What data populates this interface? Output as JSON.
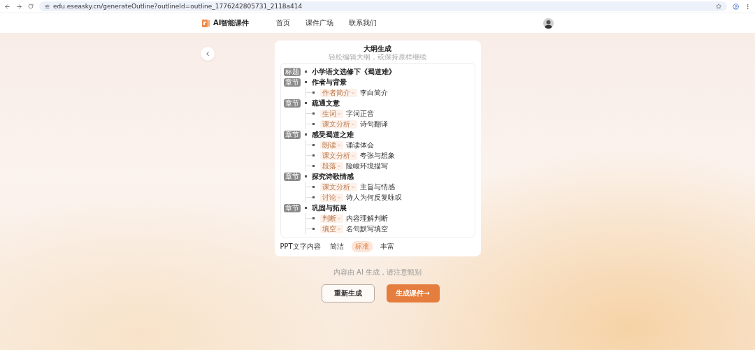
{
  "browser": {
    "url": "edu.eseasky.cn/generateOutline?outlineId=outline_1776242805731_2118a414"
  },
  "nav": {
    "brand": "AI智能课件",
    "links": [
      "首页",
      "课件广场",
      "联系我们"
    ]
  },
  "outline": {
    "title": "大纲生成",
    "subtitle": "轻松编辑大纲，或保持原样继续",
    "items": [
      {
        "tag": "标题",
        "text": "小学语文选修下《蜀道难》"
      },
      {
        "tag": "章节",
        "text": "作者与背景",
        "children": [
          {
            "type": "作者简介",
            "text": "李白简介"
          }
        ]
      },
      {
        "tag": "章节",
        "text": "疏通文意",
        "children": [
          {
            "type": "生词",
            "text": "字词正音"
          },
          {
            "type": "课文分析",
            "text": "诗句翻译"
          }
        ]
      },
      {
        "tag": "章节",
        "text": "感受蜀道之难",
        "children": [
          {
            "type": "朗读",
            "text": "诵读体会"
          },
          {
            "type": "课文分析",
            "text": "夸张与想象"
          },
          {
            "type": "段落",
            "text": "险峻环境描写"
          }
        ]
      },
      {
        "tag": "章节",
        "text": "探究诗歌情感",
        "children": [
          {
            "type": "课文分析",
            "text": "主旨与情感"
          },
          {
            "type": "讨论",
            "text": "诗人为何反复咏叹"
          }
        ]
      },
      {
        "tag": "章节",
        "text": "巩固与拓展",
        "children": [
          {
            "type": "判断",
            "text": "内容理解判断"
          },
          {
            "type": "填空",
            "text": "名句默写填空"
          }
        ]
      }
    ]
  },
  "ppt_text": {
    "label": "PPT文字内容",
    "options": [
      {
        "label": "简洁",
        "selected": false
      },
      {
        "label": "标准",
        "selected": true
      },
      {
        "label": "丰富",
        "selected": false
      }
    ]
  },
  "notice": "内容由 AI 生成，请注意甄别",
  "buttons": [
    {
      "label": "重新生成",
      "kind": "secondary"
    },
    {
      "label": "生成课件→",
      "kind": "primary"
    }
  ]
}
